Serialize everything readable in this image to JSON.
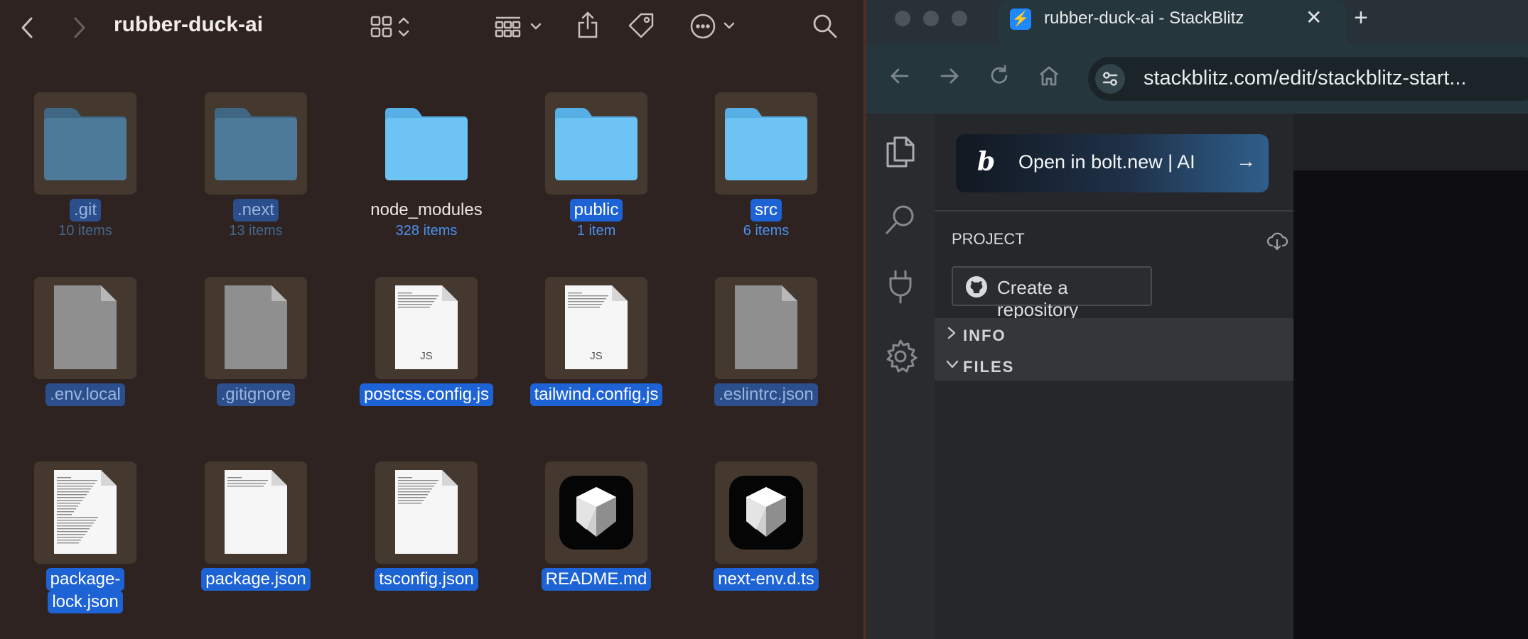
{
  "finder": {
    "title": "rubber-duck-ai",
    "toolbar_icons": [
      "back-icon",
      "forward-icon",
      "grid-view-icon",
      "group-icon",
      "share-icon",
      "tag-icon",
      "more-icon",
      "search-icon"
    ],
    "items": [
      {
        "name": "​.git",
        "label": ".git",
        "count": "10 items",
        "kind": "folder",
        "dim": true
      },
      {
        "name": "​.next",
        "label": ".next",
        "count": "13 items",
        "kind": "folder",
        "dim": true
      },
      {
        "name": "node_modules",
        "label": "node_modules",
        "count": "328 items",
        "kind": "folder-bright",
        "dim": false
      },
      {
        "name": "public",
        "label": "public",
        "count": "1 item",
        "kind": "folder-bright",
        "dim": false
      },
      {
        "name": "src",
        "label": "src",
        "count": "6 items",
        "kind": "folder-bright",
        "dim": false
      },
      {
        "name": ".env.local",
        "label": ".env.local",
        "count": "",
        "kind": "doc-gray",
        "dim": true
      },
      {
        "name": ".gitignore",
        "label": ".gitignore",
        "count": "",
        "kind": "doc-gray",
        "dim": true
      },
      {
        "name": "postcss.config.js",
        "label": "postcss.config.js",
        "count": "",
        "kind": "doc-js",
        "dim": false
      },
      {
        "name": "tailwind.config.js",
        "label": "tailwind.config.js",
        "count": "",
        "kind": "doc-js",
        "dim": false
      },
      {
        "name": ".eslintrc.json",
        "label": ".eslintrc.json",
        "count": "",
        "kind": "doc-gray",
        "dim": true
      },
      {
        "name": "package-lock.json",
        "label": "package-",
        "label2": "lock.json",
        "count": "",
        "kind": "doc-text",
        "dim": false
      },
      {
        "name": "package.json",
        "label": "package.json",
        "count": "",
        "kind": "doc-white",
        "dim": false
      },
      {
        "name": "tsconfig.json",
        "label": "tsconfig.json",
        "count": "",
        "kind": "doc-text",
        "dim": false
      },
      {
        "name": "README.md",
        "label": "README.md",
        "count": "",
        "kind": "app",
        "dim": false
      },
      {
        "name": "next-env.d.ts",
        "label": "next-env.d.ts",
        "count": "",
        "kind": "app",
        "dim": false
      }
    ],
    "js_badge": "JS"
  },
  "browser": {
    "tab_title": "rubber-duck-ai - StackBlitz",
    "tab_close": "✕",
    "new_tab": "+",
    "url": "stackblitz.com/edit/stackblitz-start..."
  },
  "stackblitz": {
    "bolt_button": "Open in bolt.new | AI",
    "bolt_arrow": "→",
    "project_label": "PROJECT",
    "create_repo": "Create a repository",
    "sections": [
      {
        "label": "INFO",
        "chev": "›"
      },
      {
        "label": "FILES",
        "chev": "⌄"
      }
    ]
  }
}
